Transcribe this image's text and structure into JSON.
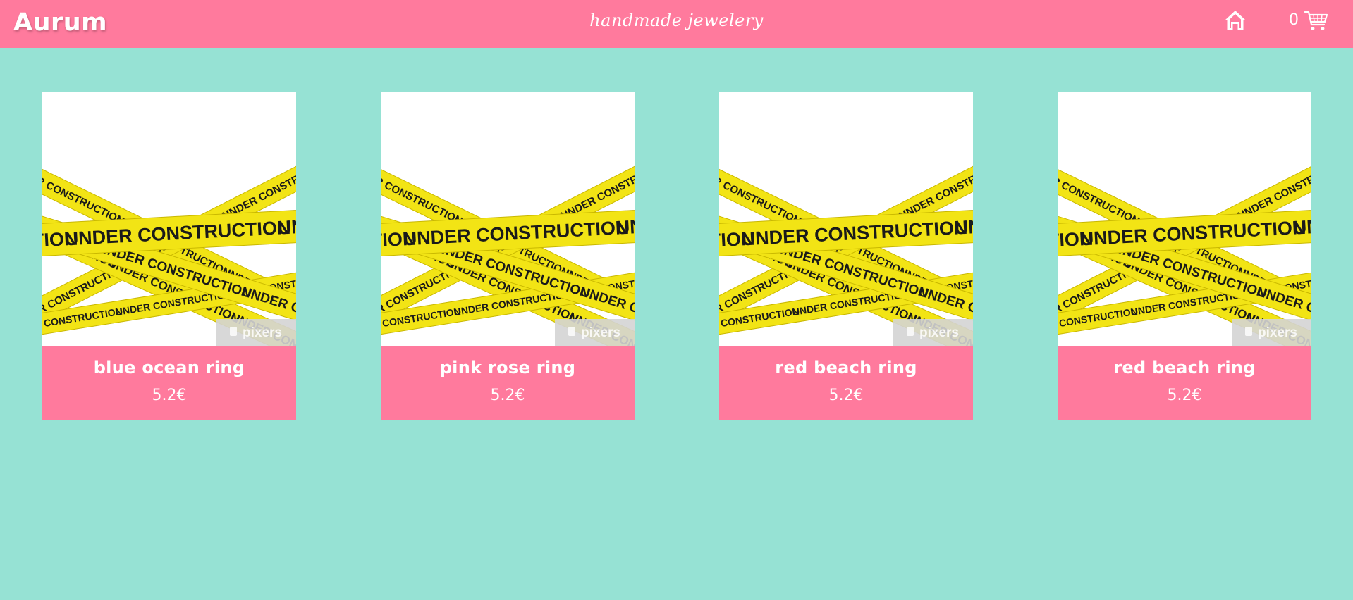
{
  "brand": {
    "name": "Aurum",
    "tagline": "handmade jewelery"
  },
  "nav": {
    "home_icon": "home-icon",
    "cart_icon": "cart-icon",
    "cart_count": "0"
  },
  "colors": {
    "header": "#ff7a9d",
    "background": "#96e2d4",
    "card_info": "#ff7a9d",
    "tape": "#f2e415"
  },
  "products": [
    {
      "name": "blue ocean ring",
      "price": "5.2€",
      "image_text": "UNDER CONSTRUCTION",
      "watermark": "pixers"
    },
    {
      "name": "pink rose ring",
      "price": "5.2€",
      "image_text": "UNDER CONSTRUCTION",
      "watermark": "pixers"
    },
    {
      "name": "red beach ring",
      "price": "5.2€",
      "image_text": "UNDER CONSTRUCTION",
      "watermark": "pixers"
    },
    {
      "name": "red beach ring",
      "price": "5.2€",
      "image_text": "UNDER CONSTRUCTION",
      "watermark": "pixers"
    }
  ]
}
